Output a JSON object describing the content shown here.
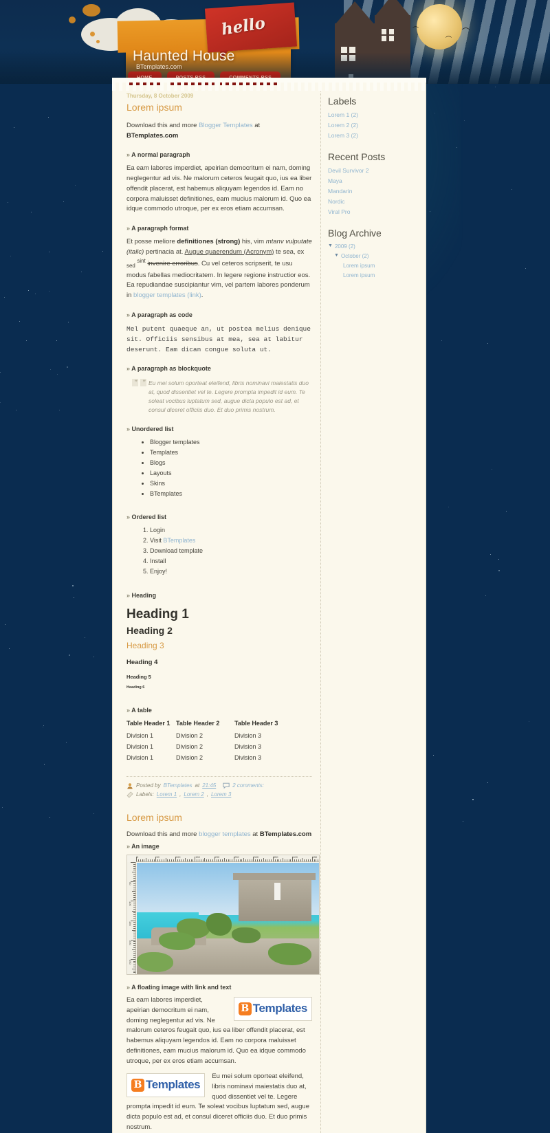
{
  "site": {
    "title": "Haunted House",
    "description": "BTemplates.com",
    "banner_word": "hello"
  },
  "nav": {
    "items": [
      {
        "label": "HOME"
      },
      {
        "label": "POSTS RSS"
      },
      {
        "label": "COMMENTS RSS"
      }
    ]
  },
  "post1": {
    "date": "Thursday, 8 October 2009",
    "title": "Lorem ipsum",
    "intro_pre": "Download this and more ",
    "intro_link": "Blogger Templates",
    "intro_mid": " at ",
    "intro_strong": "BTemplates.com",
    "sections": {
      "normal_paragraph": "A normal paragraph",
      "paragraph_format": "A paragraph format",
      "paragraph_code": "A paragraph as code",
      "paragraph_blockquote": "A paragraph as blockquote",
      "unordered_list": "Unordered list",
      "ordered_list": "Ordered list",
      "heading": "Heading",
      "table": "A table"
    },
    "normal_text": "Ea eam labores imperdiet, apeirian democritum ei nam, doming neglegentur ad vis. Ne malorum ceteros feugait quo, ius ea liber offendit placerat, est habemus aliquyam legendos id. Eam no corpora maluisset definitiones, eam mucius malorum id. Quo ea idque commodo utroque, per ex eros etiam accumsan.",
    "format": {
      "t1": "Et posse meliore ",
      "strong": "definitiones (strong)",
      "t2": " his, vim ",
      "italic_lead": "mtanv",
      "italic": " vulputate (italic)",
      "t3": " pertinacia at. ",
      "acronym": "Augue quaerendum (Acronym)",
      "t4": " te sea, ex ",
      "sub": "sed",
      "sup": "sint",
      "strike": "invenire erroribus",
      "t5": ". Cu vel ceteros scripserit, te usu modus fabellas mediocritatem. In legere regione instructior eos. Ea repudiandae suscipiantur vim, vel partem labores ponderum in ",
      "link": "blogger templates (link)",
      "t6": "."
    },
    "code_text": "Mel putent quaeque an, ut postea melius denique sit. Officiis sensibus at mea, sea at labitur deserunt. Eam dican congue soluta ut.",
    "blockquote_text": "Eu mei solum oporteat eleifend, libris nominavi maiestatis duo at, quod dissentiet vel te. Legere prompta impedit id eum. Te soleat vocibus luptatum sed, augue dicta populo est ad, et consul diceret officiis duo. Et duo primis nostrum.",
    "ul_items": [
      "Blogger templates",
      "Templates",
      "Blogs",
      "Layouts",
      "Skins",
      "BTemplates"
    ],
    "ol_items": [
      {
        "pre": "Login",
        "link": "",
        "post": ""
      },
      {
        "pre": "Visit ",
        "link": "BTemplates",
        "post": ""
      },
      {
        "pre": "Download template",
        "link": "",
        "post": ""
      },
      {
        "pre": "Install",
        "link": "",
        "post": ""
      },
      {
        "pre": "Enjoy!",
        "link": "",
        "post": ""
      }
    ],
    "headings": {
      "h1": "Heading 1",
      "h2": "Heading 2",
      "h3": "Heading 3",
      "h4": "Heading 4",
      "h5": "Heading 5",
      "h6": "Heading 6"
    },
    "table": {
      "headers": [
        "Table Header 1",
        "Table Header 2",
        "Table Header 3"
      ],
      "rows": [
        [
          "Division 1",
          "Division 2",
          "Division 3"
        ],
        [
          "Division 1",
          "Division 2",
          "Division 3"
        ],
        [
          "Division 1",
          "Division 2",
          "Division 3"
        ]
      ]
    },
    "footer": {
      "posted_by_label": "Posted by",
      "author": "BTemplates",
      "at_label": "at",
      "time": "21:45",
      "comments": "2 comments:",
      "labels_label": "Labels:",
      "labels": [
        "Lorem 1",
        "Lorem 2",
        "Lorem 3"
      ]
    }
  },
  "post2": {
    "title": "Lorem ipsum",
    "intro_pre": "Download this and more ",
    "intro_link": "blogger templates",
    "intro_mid": " at ",
    "intro_strong": "BTemplates.com",
    "sections": {
      "an_image": "An image",
      "floating_image": "A floating image with link and text"
    },
    "float_text_1": "Ea eam labores imperdiet, apeirian democritum ei nam, doming neglegentur ad vis. Ne malorum ceteros feugait quo, ius ea liber offendit placerat, est habemus aliquyam legendos id. Eam no corpora maluisset definitiones, eam mucius malorum id. Quo ea idque commodo utroque, per ex eros etiam accumsan.",
    "float_text_2": "Eu mei solum oporteat eleifend, libris nominavi maiestatis duo at, quod dissentiet vel te. Legere prompta impedit id eum. Te soleat vocibus luptatum sed, augue dicta populo est ad, et consul diceret officiis duo. Et duo primis nostrum.",
    "logo": {
      "b": "B",
      "word": "Templates"
    },
    "image_ruler_labels": [
      "0",
      "50",
      "100",
      "150",
      "200",
      "250",
      "300",
      "350",
      "400",
      "450"
    ],
    "image_ruler_v_labels": [
      "50",
      "100",
      "150",
      "200",
      "250"
    ]
  },
  "sidebar": {
    "labels": {
      "heading": "Labels",
      "items": [
        {
          "label": "Lorem 1 (2)"
        },
        {
          "label": "Lorem 2 (2)"
        },
        {
          "label": "Lorem 3 (2)"
        }
      ]
    },
    "recent_posts": {
      "heading": "Recent Posts",
      "items": [
        {
          "label": "Devil Survivor 2"
        },
        {
          "label": "Maya"
        },
        {
          "label": "Mandarin"
        },
        {
          "label": "Nordic"
        },
        {
          "label": "Viral Pro"
        }
      ]
    },
    "blog_archive": {
      "heading": "Blog Archive",
      "year": "2009 (2)",
      "month": "October (2)",
      "posts": [
        {
          "label": "Lorem ipsum"
        },
        {
          "label": "Lorem ipsum"
        }
      ],
      "expand_glyph": "▼"
    }
  },
  "colors": {
    "page_bg": "#0a2c50",
    "content_bg": "#fbf8ec",
    "accent_orange": "#d79a45",
    "link_blue": "#8fb4cf",
    "tab_red": "#a5241b",
    "logo_orange": "#f57d20",
    "logo_blue": "#2f5fa8"
  }
}
